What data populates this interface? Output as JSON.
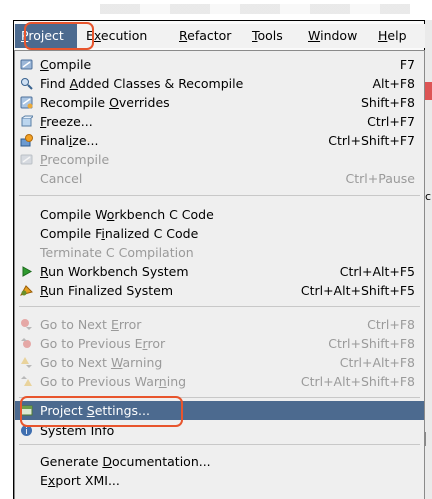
{
  "menubar": {
    "items": [
      {
        "pre": "",
        "key": "P",
        "post": "roject"
      },
      {
        "pre": "E",
        "key": "x",
        "post": "ecution"
      },
      {
        "pre": "",
        "key": "R",
        "post": "efactor"
      },
      {
        "pre": "",
        "key": "T",
        "post": "ools"
      },
      {
        "pre": "",
        "key": "W",
        "post": "indow"
      },
      {
        "pre": "",
        "key": "H",
        "post": "elp"
      }
    ]
  },
  "menu": {
    "items": [
      {
        "pre": "",
        "key": "C",
        "post": "ompile",
        "shortcut": "F7",
        "icon": "compile-icon"
      },
      {
        "pre": "Find ",
        "key": "A",
        "post": "dded Classes & Recompile",
        "shortcut": "Alt+F8",
        "icon": "find-recompile-icon"
      },
      {
        "pre": "Recompile ",
        "key": "O",
        "post": "verrides",
        "shortcut": "Shift+F8",
        "icon": "recompile-overrides-icon"
      },
      {
        "pre": "",
        "key": "F",
        "post": "reeze...",
        "shortcut": "Ctrl+F7",
        "icon": "freeze-icon"
      },
      {
        "pre": "Final",
        "key": "i",
        "post": "ze...",
        "shortcut": "Ctrl+Shift+F7",
        "icon": "finalize-icon"
      },
      {
        "pre": "",
        "key": "P",
        "post": "recompile",
        "shortcut": "",
        "icon": "precompile-icon"
      },
      {
        "pre": "Cancel",
        "key": "",
        "post": "",
        "shortcut": "Ctrl+Pause",
        "icon": ""
      },
      {
        "pre": "Compile W",
        "key": "o",
        "post": "rkbench C Code",
        "shortcut": "",
        "icon": ""
      },
      {
        "pre": "Compile F",
        "key": "i",
        "post": "nalized C Code",
        "shortcut": "",
        "icon": ""
      },
      {
        "pre": "Terminate C Compilation",
        "key": "",
        "post": "",
        "shortcut": "",
        "icon": ""
      },
      {
        "pre": "",
        "key": "R",
        "post": "un Workbench System",
        "shortcut": "Ctrl+Alt+F5",
        "icon": "run-icon"
      },
      {
        "pre": "",
        "key": "R",
        "post": "un Finalized System",
        "shortcut": "Ctrl+Alt+Shift+F5",
        "icon": "run-finalized-icon"
      },
      {
        "pre": "Go to Next ",
        "key": "E",
        "post": "rror",
        "shortcut": "Ctrl+F8",
        "icon": "next-error-icon"
      },
      {
        "pre": "Go to Previous E",
        "key": "r",
        "post": "ror",
        "shortcut": "Ctrl+Shift+F8",
        "icon": "previous-error-icon"
      },
      {
        "pre": "Go to Next ",
        "key": "W",
        "post": "arning",
        "shortcut": "Ctrl+Alt+F8",
        "icon": "next-warning-icon"
      },
      {
        "pre": "Go to Previous War",
        "key": "n",
        "post": "ing",
        "shortcut": "Ctrl+Alt+Shift+F8",
        "icon": "previous-warning-icon"
      },
      {
        "pre": "Project ",
        "key": "S",
        "post": "ettings...",
        "shortcut": "",
        "icon": "project-settings-icon"
      },
      {
        "pre": "System Info",
        "key": "",
        "post": "",
        "shortcut": "",
        "icon": "system-info-icon"
      },
      {
        "pre": "Generate ",
        "key": "D",
        "post": "ocumentation...",
        "shortcut": "",
        "icon": ""
      },
      {
        "pre": "E",
        "key": "x",
        "post": "port XMI...",
        "shortcut": "",
        "icon": ""
      }
    ]
  },
  "colors": {
    "highlight": "#4c6a8f",
    "callout": "#e8552d",
    "disabled_text": "#9a9a9a"
  }
}
